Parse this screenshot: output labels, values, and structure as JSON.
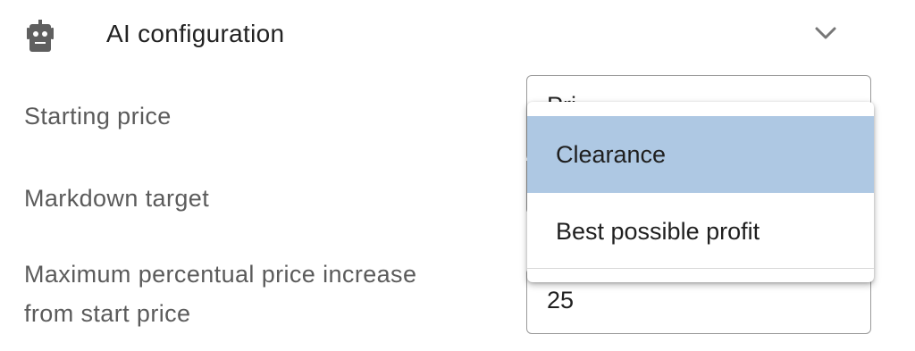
{
  "header": {
    "icon": "robot-icon",
    "title": "AI configuration",
    "toggle_icon": "chevron-down-icon"
  },
  "fields": {
    "starting_price": {
      "label": "Starting price",
      "value": "Pri"
    },
    "markdown_target": {
      "label": "Markdown target"
    },
    "max_increase": {
      "label_line1": "Maximum percentual price increase",
      "label_line2": "from start price",
      "value": "25"
    }
  },
  "dropdown": {
    "options": [
      {
        "label": "Clearance",
        "selected": true
      },
      {
        "label": "Best possible profit",
        "selected": false
      }
    ],
    "selected_color": "#aec8e3"
  }
}
